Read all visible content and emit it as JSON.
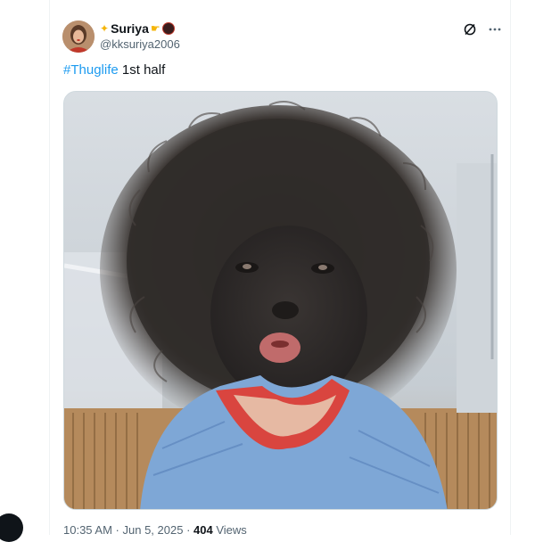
{
  "tweet": {
    "author": {
      "display_name": "Suriya",
      "handle": "@kksuriya2006",
      "name_emojis": [
        "sparkle-star-emoji",
        "pointing-hand-emoji",
        "badge-emoji"
      ]
    },
    "text": {
      "hashtag": "#Thuglife",
      "rest": " 1st half"
    },
    "media": {
      "alt": "photo of a baby with soot-covered face and very fuzzy black hair"
    },
    "meta": {
      "time": "10:35 AM",
      "separator1": " · ",
      "date": "Jun 5, 2025",
      "separator2": " · ",
      "views_count": "404",
      "views_label": " Views"
    },
    "actions": {
      "grok_icon": "slash-circle-icon",
      "more_icon": "more-horizontal-icon"
    }
  },
  "colors": {
    "accent": "#1d9bf0",
    "text": "#0f1419",
    "muted": "#536471",
    "border": "#eff3f4"
  }
}
